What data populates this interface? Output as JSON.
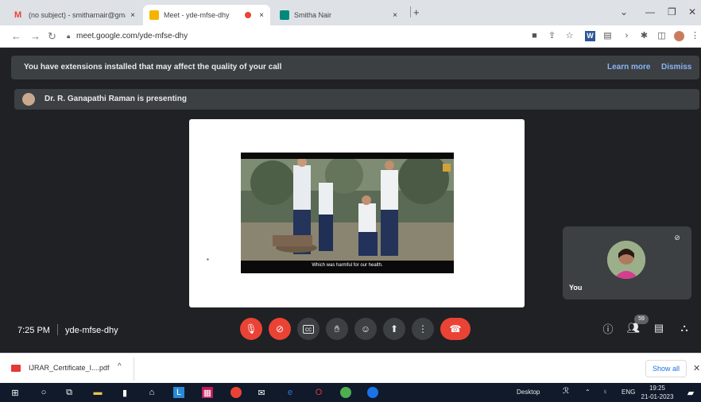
{
  "browser": {
    "tabs": [
      {
        "title": "(no subject) - smitharnair@gma",
        "favicon": "gmail-icon",
        "color": "#ea4335"
      },
      {
        "title": "Meet - yde-mfse-dhy",
        "favicon": "meet-icon",
        "color": "#f4b400"
      },
      {
        "title": "Smitha Nair",
        "favicon": "jamboard-icon",
        "color": "#00897b"
      }
    ],
    "tab_close": "×",
    "new_tab": "+",
    "url": "meet.google.com/yde-mfse-dhy"
  },
  "meet": {
    "banner_text": "You have extensions installed that may affect the quality of your call",
    "learn_more": "Learn more",
    "dismiss": "Dismiss",
    "presenting_text": "Dr. R. Ganapathi Raman is presenting",
    "caption": "Which was harmful for our health.",
    "self_name": "You",
    "time": "7:25 PM",
    "meeting_code": "yde-mfse-dhy",
    "participant_count": "59",
    "accent_red": "#ea4335"
  },
  "downloads": {
    "file_name": "IJRAR_Certificate_I....pdf",
    "show_all": "Show all"
  },
  "taskbar": {
    "desktop_label": "Desktop",
    "language": "ENG",
    "time": "19:25",
    "date": "21-01-2023"
  }
}
